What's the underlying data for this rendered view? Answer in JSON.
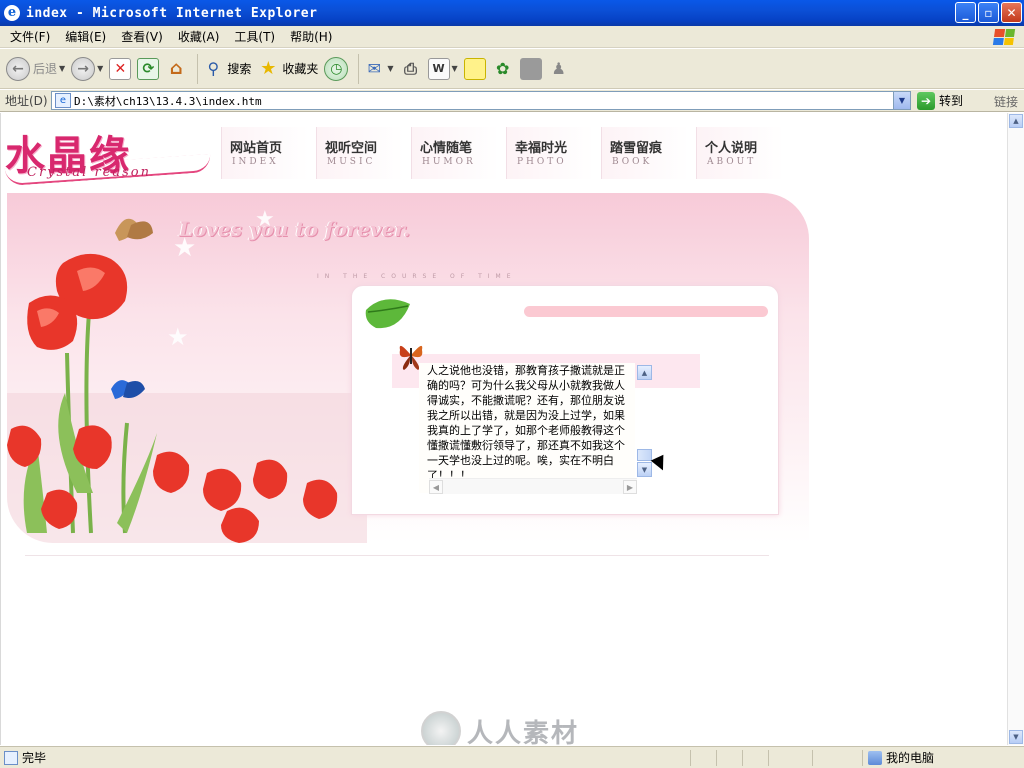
{
  "window": {
    "title": "index - Microsoft Internet Explorer"
  },
  "menu": [
    "文件(F)",
    "编辑(E)",
    "查看(V)",
    "收藏(A)",
    "工具(T)",
    "帮助(H)"
  ],
  "toolbar": {
    "back": "后退",
    "search": "搜索",
    "favorites": "收藏夹"
  },
  "address": {
    "label": "地址(D)",
    "url": "D:\\素材\\ch13\\13.4.3\\index.htm",
    "go": "转到",
    "links": "链接"
  },
  "site": {
    "logo_cn": "水晶缘",
    "logo_en": "Crystal reason",
    "nav": [
      {
        "cn": "网站首页",
        "en": "INDEX"
      },
      {
        "cn": "视听空间",
        "en": "MUSIC"
      },
      {
        "cn": "心情随笔",
        "en": "HUMOR"
      },
      {
        "cn": "幸福时光",
        "en": "PHOTO"
      },
      {
        "cn": "踏雪留痕",
        "en": "BOOK"
      },
      {
        "cn": "个人说明",
        "en": "ABOUT"
      }
    ],
    "tagline": "Loves you to forever.",
    "tagline_sub": "IN THE COURSE OF TIME",
    "article": "人之说他也没错，那教育孩子撒谎就是正确的吗？可为什么我父母从小就教我做人得诚实，不能撒谎呢？还有，那位朋友说我之所以出错，就是因为没上过学，如果我真的上了学了，如那个老师般教得这个懂撒谎懂敷衍领导了，那还真不如我这个一天学也没上过的呢。唉，实在不明白了！！！"
  },
  "watermark": "人人素材",
  "status": {
    "text": "完毕",
    "zone": "我的电脑"
  }
}
